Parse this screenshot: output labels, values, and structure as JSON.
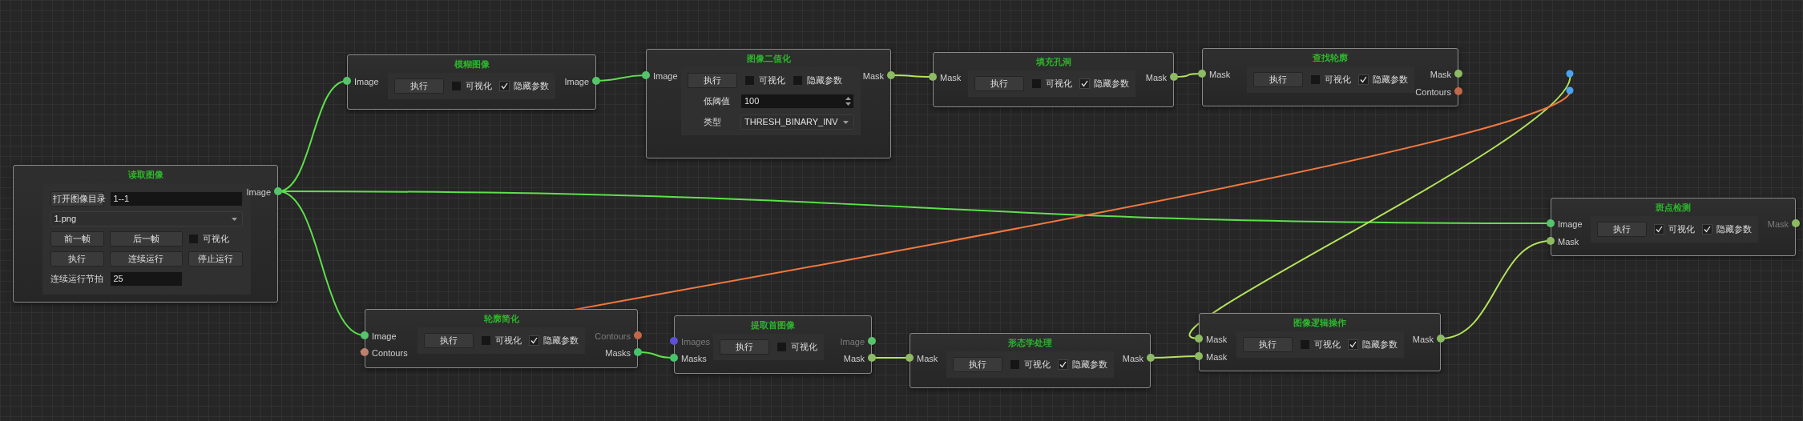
{
  "nodes": [
    {
      "kind": "operator",
      "title": "模糊图像",
      "inputs": [
        {
          "label": "Image",
          "color": "#56c46a",
          "dimmed": false
        }
      ],
      "outputs": [
        {
          "label": "Image",
          "color": "#56c46a",
          "dimmed": false
        }
      ],
      "rows": [
        [
          {
            "kind": "button",
            "label": "执行"
          },
          {
            "kind": "checkbox",
            "label": "可视化",
            "checked": false
          },
          {
            "kind": "checkbox",
            "label": "隐藏参数",
            "checked": true
          }
        ]
      ]
    },
    {
      "kind": "operator",
      "title": "图像二值化",
      "inputs": [
        {
          "label": "Image",
          "color": "#56c46a",
          "dimmed": false
        }
      ],
      "outputs": [
        {
          "label": "Mask",
          "color": "#8dbb62",
          "dimmed": false
        }
      ],
      "rows": [
        [
          {
            "kind": "button",
            "label": "执行"
          },
          {
            "kind": "checkbox",
            "label": "可视化",
            "checked": false
          },
          {
            "kind": "checkbox",
            "label": "隐藏参数",
            "checked": false
          }
        ],
        [
          {
            "kind": "label",
            "label": "低阈值"
          },
          {
            "kind": "spinbox",
            "value": "100"
          }
        ],
        [
          {
            "kind": "label",
            "label": "类型"
          },
          {
            "kind": "select",
            "value": "THRESH_BINARY_INV"
          }
        ]
      ]
    },
    {
      "kind": "operator",
      "title": "填充孔洞",
      "inputs": [
        {
          "label": "Mask",
          "color": "#8dbb62",
          "dimmed": false
        }
      ],
      "outputs": [
        {
          "label": "Mask",
          "color": "#8dbb62",
          "dimmed": false
        }
      ],
      "rows": [
        [
          {
            "kind": "button",
            "label": "执行"
          },
          {
            "kind": "checkbox",
            "label": "可视化",
            "checked": false
          },
          {
            "kind": "checkbox",
            "label": "隐藏参数",
            "checked": true
          }
        ]
      ]
    },
    {
      "kind": "operator",
      "title": "查找轮廓",
      "inputs": [
        {
          "label": "Mask",
          "color": "#8dbb62",
          "dimmed": false
        }
      ],
      "outputs": [
        {
          "label": "Mask",
          "color": "#8dbb62",
          "dimmed": false
        },
        {
          "label": "Contours",
          "color": "#c0694a",
          "dimmed": false
        }
      ],
      "rows": [
        [
          {
            "kind": "button",
            "label": "执行"
          },
          {
            "kind": "checkbox",
            "label": "可视化",
            "checked": false
          },
          {
            "kind": "checkbox",
            "label": "隐藏参数",
            "checked": true
          }
        ]
      ]
    },
    {
      "kind": "reader",
      "title": "读取图像",
      "outputs": [
        {
          "label": "Image",
          "color": "#56c46a",
          "dimmed": false
        }
      ],
      "rows": [
        [
          {
            "kind": "button",
            "label": "打开图像目录"
          },
          {
            "kind": "field",
            "value": "1--1"
          }
        ],
        [
          {
            "kind": "select",
            "value": "1.png"
          }
        ],
        [
          {
            "kind": "button",
            "label": "前一帧"
          },
          {
            "kind": "button",
            "label": "后一帧"
          },
          {
            "kind": "checkbox",
            "label": "可视化",
            "checked": false
          }
        ],
        [
          {
            "kind": "button",
            "label": "执行"
          },
          {
            "kind": "button",
            "label": "连续运行"
          },
          {
            "kind": "button",
            "label": "停止运行"
          }
        ],
        [
          {
            "kind": "label",
            "label": "连续运行节拍"
          },
          {
            "kind": "field",
            "value": "25"
          }
        ]
      ]
    },
    {
      "kind": "operator",
      "title": "斑点检测",
      "inputs": [
        {
          "label": "Image",
          "color": "#56c46a",
          "dimmed": false
        },
        {
          "label": "Mask",
          "color": "#8dbb62",
          "dimmed": false
        }
      ],
      "outputs": [
        {
          "label": "Mask",
          "color": "#8dbb62",
          "dimmed": true
        }
      ],
      "rows": [
        [
          {
            "kind": "button",
            "label": "执行"
          },
          {
            "kind": "checkbox",
            "label": "可视化",
            "checked": true
          },
          {
            "kind": "checkbox",
            "label": "隐藏参数",
            "checked": true
          }
        ]
      ]
    },
    {
      "kind": "operator",
      "title": "轮廓简化",
      "inputs": [
        {
          "label": "Image",
          "color": "#56c46a",
          "dimmed": false
        },
        {
          "label": "Contours",
          "color": "#c08070",
          "dimmed": false
        }
      ],
      "outputs": [
        {
          "label": "Contours",
          "color": "#c0694a",
          "dimmed": true
        },
        {
          "label": "Masks",
          "color": "#47c46a",
          "dimmed": false
        }
      ],
      "rows": [
        [
          {
            "kind": "button",
            "label": "执行"
          },
          {
            "kind": "checkbox",
            "label": "可视化",
            "checked": false
          },
          {
            "kind": "checkbox",
            "label": "隐藏参数",
            "checked": true
          }
        ]
      ]
    },
    {
      "kind": "operator",
      "title": "提取首图像",
      "inputs": [
        {
          "label": "Images",
          "color": "#5d4fd8",
          "dimmed": true
        },
        {
          "label": "Masks",
          "color": "#47c46a",
          "dimmed": false
        }
      ],
      "outputs": [
        {
          "label": "Image",
          "color": "#56c46a",
          "dimmed": true
        },
        {
          "label": "Mask",
          "color": "#8dbb62",
          "dimmed": false
        }
      ],
      "rows": [
        [
          {
            "kind": "button",
            "label": "执行"
          },
          {
            "kind": "checkbox",
            "label": "可视化",
            "checked": false
          }
        ]
      ]
    },
    {
      "kind": "operator",
      "title": "形态学处理",
      "inputs": [
        {
          "label": "Mask",
          "color": "#8dbb62",
          "dimmed": false
        }
      ],
      "outputs": [
        {
          "label": "Mask",
          "color": "#8dbb62",
          "dimmed": false
        }
      ],
      "rows": [
        [
          {
            "kind": "button",
            "label": "执行"
          },
          {
            "kind": "checkbox",
            "label": "可视化",
            "checked": false
          },
          {
            "kind": "checkbox",
            "label": "隐藏参数",
            "checked": true
          }
        ]
      ]
    },
    {
      "kind": "operator",
      "title": "图像逻辑操作",
      "inputs": [
        {
          "label": "Mask",
          "color": "#8dbb62",
          "dimmed": false
        },
        {
          "label": "Mask",
          "color": "#8dbb62",
          "dimmed": false
        }
      ],
      "outputs": [
        {
          "label": "Mask",
          "color": "#8dbb62",
          "dimmed": false
        }
      ],
      "rows": [
        [
          {
            "kind": "button",
            "label": "执行"
          },
          {
            "kind": "checkbox",
            "label": "可视化",
            "checked": false
          },
          {
            "kind": "checkbox",
            "label": "隐藏参数",
            "checked": true
          }
        ]
      ]
    }
  ]
}
